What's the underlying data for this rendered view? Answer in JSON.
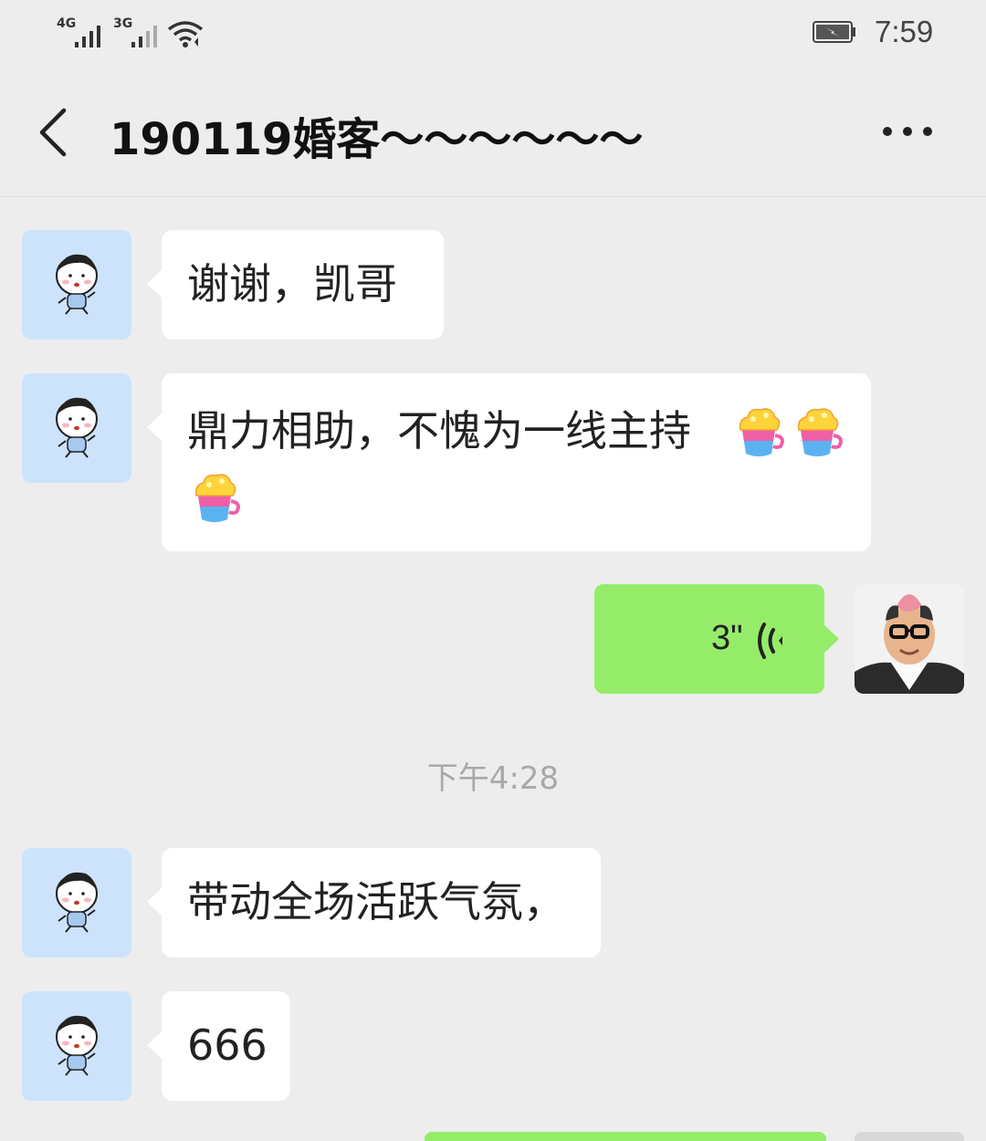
{
  "status_bar": {
    "network_1": "4G",
    "network_2": "3G",
    "time": "7:59",
    "battery_icon": "charging-battery-icon",
    "wifi_icon": "wifi-icon"
  },
  "header": {
    "title": "190119婚客～～～～～～",
    "back_icon": "chevron-left-icon",
    "more_icon": "more-dots-icon"
  },
  "messages": [
    {
      "side": "left",
      "text": "谢谢，凯哥"
    },
    {
      "side": "left",
      "text": "鼎力相助，不愧为一线主持",
      "emoji": "coffee-cup-emoji",
      "emoji_count": 3
    },
    {
      "side": "right",
      "type": "voice",
      "duration": "3\""
    },
    {
      "side": "left",
      "text": "带动全场活跃气氛，"
    },
    {
      "side": "left",
      "text": "666"
    }
  ],
  "timestamp": "下午4:28",
  "colors": {
    "background": "#ededed",
    "self_bubble": "#95ec69",
    "other_bubble": "#ffffff",
    "avatar_bg": "#cde3fb"
  }
}
